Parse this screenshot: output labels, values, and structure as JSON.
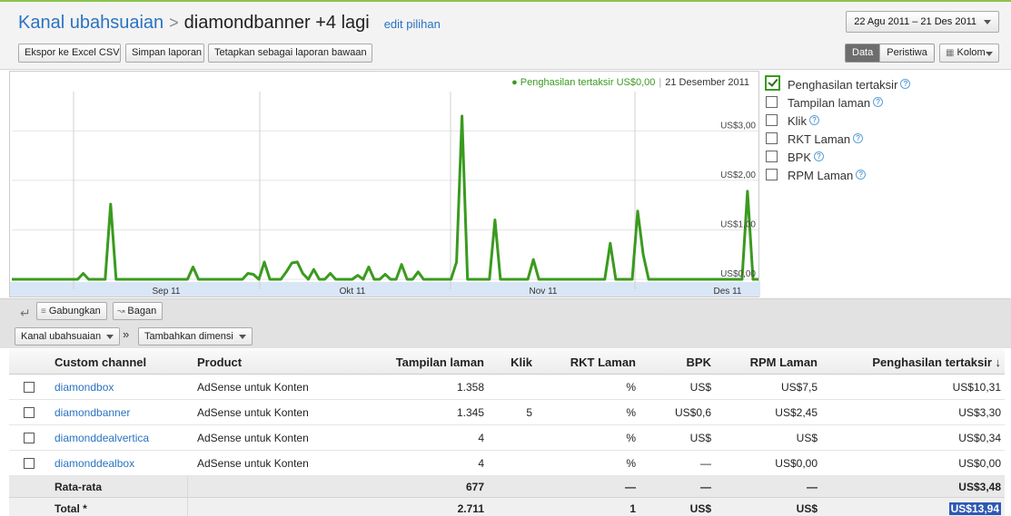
{
  "header": {
    "breadcrumb_parent": "Kanal ubahsuaian",
    "breadcrumb_sep": ">",
    "breadcrumb_current": "diamondbanner +4 lagi",
    "edit_link": "edit pilihan",
    "date_range": "22 Agu 2011 – 21 Des 2011"
  },
  "toolbar": {
    "export_label": "Ekspor ke Excel CSV",
    "save_label": "Simpan laporan",
    "default_label": "Tetapkan sebagai laporan bawaan",
    "data_label": "Data",
    "events_label": "Peristiwa",
    "columns_label": "Kolom"
  },
  "chart_legend": {
    "series": "Penghasilan tertaksir US$0,00",
    "date": "21 Desember 2011"
  },
  "chart_data": {
    "type": "line",
    "x_tick_labels": [
      "Sep 11",
      "Okt 11",
      "Nov 11",
      "Des 11"
    ],
    "y_tick_labels": [
      "US$0,00",
      "US$1,00",
      "US$2,00",
      "US$3,00"
    ],
    "ylim": [
      0,
      3.3
    ],
    "color": "#3a9a1f",
    "series": [
      {
        "values": [
          0,
          0,
          0,
          0,
          0,
          0,
          0,
          0,
          0,
          0,
          0,
          0,
          0,
          0.12,
          0,
          0,
          0,
          0,
          1.52,
          0,
          0,
          0,
          0,
          0,
          0,
          0,
          0,
          0,
          0,
          0,
          0,
          0,
          0,
          0.25,
          0,
          0,
          0,
          0,
          0,
          0,
          0,
          0,
          0,
          0.12,
          0.1,
          0,
          0.35,
          0,
          0,
          0,
          0.15,
          0.33,
          0.35,
          0.12,
          0,
          0.2,
          0,
          0,
          0.12,
          0,
          0,
          0,
          0,
          0.08,
          0,
          0.25,
          0,
          0,
          0.1,
          0,
          0,
          0.3,
          0,
          0,
          0.15,
          0,
          0,
          0,
          0,
          0,
          0,
          0.35,
          3.3,
          0,
          0,
          0,
          0,
          0,
          1.2,
          0,
          0,
          0,
          0,
          0,
          0,
          0.4,
          0,
          0,
          0,
          0,
          0,
          0,
          0,
          0,
          0,
          0,
          0,
          0,
          0,
          0.73,
          0,
          0,
          0,
          0,
          1.38,
          0.5,
          0,
          0,
          0,
          0,
          0,
          0,
          0,
          0,
          0,
          0,
          0,
          0,
          0,
          0,
          0,
          0,
          0,
          0,
          1.78,
          0,
          0
        ]
      }
    ]
  },
  "metrics": [
    {
      "label": "Penghasilan tertaksir",
      "checked": true
    },
    {
      "label": "Tampilan laman",
      "checked": false
    },
    {
      "label": "Klik",
      "checked": false
    },
    {
      "label": "RKT Laman",
      "checked": false
    },
    {
      "label": "BPK",
      "checked": false
    },
    {
      "label": "RPM Laman",
      "checked": false
    }
  ],
  "help_glyph": "?",
  "actions": {
    "merge_label": "Gabungkan",
    "chart_label": "Bagan",
    "dimension_label": "Kanal ubahsuaian",
    "arrow": "»",
    "add_dimension_label": "Tambahkan dimensi"
  },
  "table": {
    "headers": {
      "channel": "Custom channel",
      "product": "Product",
      "pageviews": "Tampilan laman",
      "clicks": "Klik",
      "ctr": "RKT Laman",
      "cpc": "BPK",
      "rpm": "RPM Laman",
      "earnings": "Penghasilan tertaksir ↓"
    },
    "rows": [
      {
        "channel": "diamondbox",
        "product": "AdSense untuk Konten",
        "pageviews": "1.358",
        "clicks": "",
        "ctr": "%",
        "cpc": "US$",
        "rpm": "US$7,5",
        "earnings": "US$10,31"
      },
      {
        "channel": "diamondbanner",
        "product": "AdSense untuk Konten",
        "pageviews": "1.345",
        "clicks": "5",
        "ctr": "%",
        "cpc": "US$0,6",
        "rpm": "US$2,45",
        "earnings": "US$3,30"
      },
      {
        "channel": "diamonddealvertica",
        "product": "AdSense untuk Konten",
        "pageviews": "4",
        "clicks": "",
        "ctr": "%",
        "cpc": "US$",
        "rpm": "US$",
        "earnings": "US$0,34"
      },
      {
        "channel": "diamonddealbox",
        "product": "AdSense untuk Konten",
        "pageviews": "4",
        "clicks": "",
        "ctr": "%",
        "cpc": "—",
        "rpm": "US$0,00",
        "earnings": "US$0,00"
      }
    ],
    "average": {
      "label": "Rata-rata",
      "pageviews": "677",
      "ctr": "—",
      "cpc": "—",
      "rpm": "—",
      "earnings": "US$3,48"
    },
    "total": {
      "label": "Total *",
      "pageviews": "2.711",
      "clicks": "",
      "ctr": "1",
      "cpc": "US$",
      "rpm": "US$",
      "earnings": "US$13,94"
    }
  }
}
